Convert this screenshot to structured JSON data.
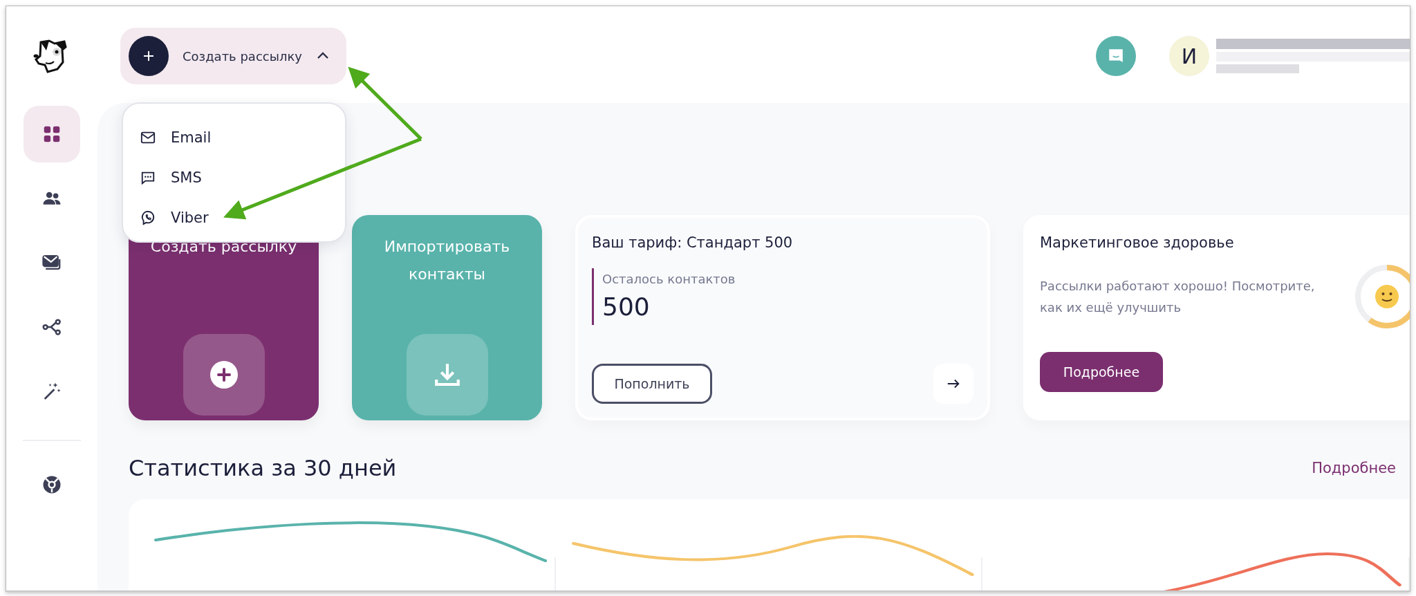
{
  "sidebar": {
    "items": [
      {
        "kind": "grid",
        "selected": true
      },
      {
        "kind": "people",
        "selected": false
      },
      {
        "kind": "mail",
        "selected": false
      },
      {
        "kind": "flow",
        "selected": false
      },
      {
        "kind": "wand",
        "selected": false
      }
    ],
    "bottom_items": [
      {
        "kind": "help",
        "selected": false
      }
    ]
  },
  "create_button": {
    "label": "Создать рассылку",
    "expanded": true
  },
  "dropdown": {
    "items": [
      {
        "kind": "email",
        "label": "Email"
      },
      {
        "kind": "sms",
        "label": "SMS"
      },
      {
        "kind": "viber",
        "label": "Viber"
      }
    ]
  },
  "user": {
    "initial": "И"
  },
  "cards": [
    {
      "kind": "create",
      "title": "Создать рассылку",
      "color": "#7b2f6f"
    },
    {
      "kind": "import",
      "title": "Импортировать контакты",
      "color": "#59b3ab"
    },
    {
      "kind": "tariff",
      "title": "Ваш тариф: Стандарт 500",
      "label": "Осталось контактов",
      "value": "500",
      "button": "Пополнить"
    },
    {
      "kind": "health",
      "title": "Маркетинговое здоровье",
      "text": "Рассылки работают хорошо! Посмотрите, как их ещё улучшить",
      "button": "Подробнее"
    }
  ],
  "stats": {
    "title": "Статистика за 30 дней",
    "link": "Подробнее",
    "sparklines": [
      {
        "color": "#59b3ab"
      },
      {
        "color": "#f5c46a"
      },
      {
        "color": "#ee705a"
      }
    ]
  }
}
